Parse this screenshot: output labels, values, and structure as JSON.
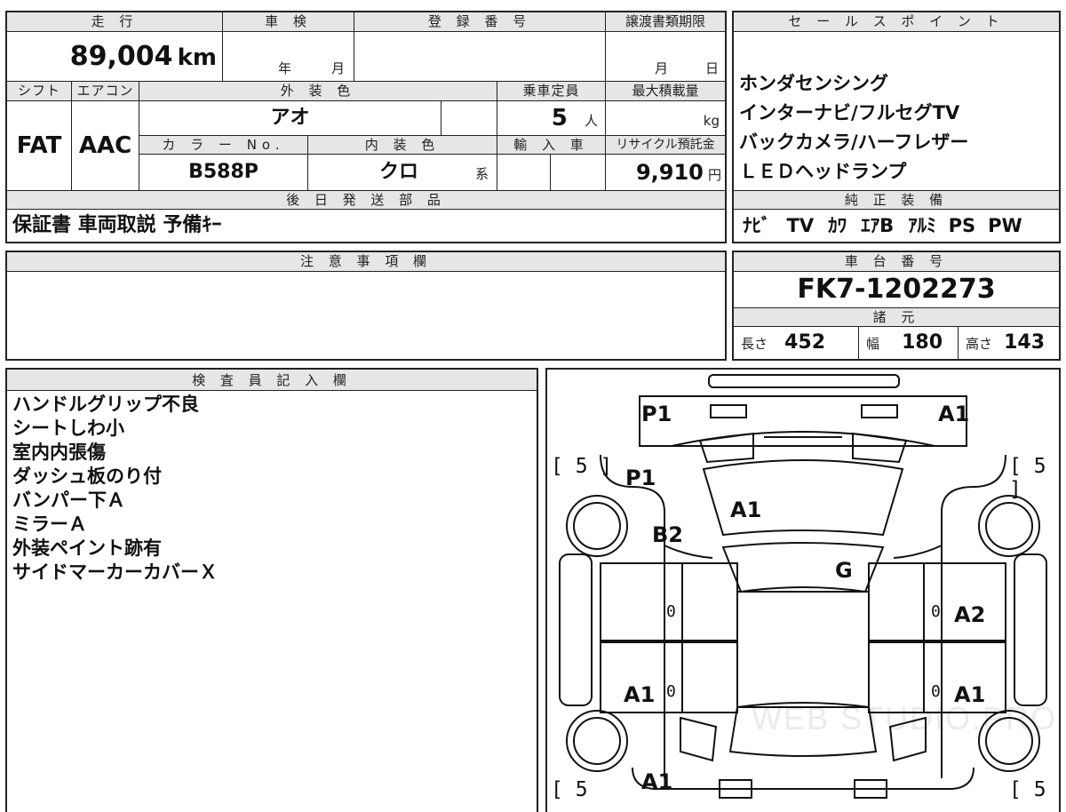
{
  "vehicle": {
    "mileage_label": "走 行",
    "mileage_value": "89,004",
    "mileage_unit": "km",
    "inspection_label": "車 検",
    "inspection_year_unit": "年",
    "inspection_month_unit": "月",
    "registration_label": "登 録 番 号",
    "transfer_deadline_label": "譲渡書類期限",
    "transfer_month_unit": "月",
    "transfer_day_unit": "日",
    "shift_label": "シフト",
    "shift_value": "FAT",
    "ac_label": "エアコン",
    "ac_value": "AAC",
    "exterior_color_label": "外 装 色",
    "exterior_color_value": "アオ",
    "capacity_label": "乗車定員",
    "capacity_value": "5",
    "capacity_unit": "人",
    "max_load_label": "最大積載量",
    "max_load_unit": "kg",
    "color_no_label": "カ ラ ー No.",
    "color_no_value": "B588P",
    "interior_color_label": "内 装 色",
    "interior_color_value": "クロ",
    "interior_color_suffix": "系",
    "import_label": "輸 入 車",
    "recycle_label": "リサイクル預託金",
    "recycle_value": "9,910",
    "recycle_unit": "円",
    "later_parts_label": "後 日 発 送 部 品",
    "later_parts_value": "保証書 車両取説 予備ｷｰ"
  },
  "sales_points": {
    "label": "セ ー ル ス ポ イ ン ト",
    "items": [
      "ホンダセンシング",
      "インターナビ/フルセグTV",
      "バックカメラ/ハーフレザー",
      "ＬＥＤヘッドランプ"
    ]
  },
  "equipment": {
    "label": "純 正 装 備",
    "items": [
      "ﾅﾋﾞ",
      "TV",
      "ｶﾜ",
      "ｴｱB",
      "ｱﾙﾐ",
      "PS",
      "PW"
    ]
  },
  "notes": {
    "label": "注 意 事 項 欄"
  },
  "chassis": {
    "label": "車 台 番 号",
    "value": "FK7-1202273",
    "specs_label": "諸 元",
    "length_label": "長さ",
    "length_value": "452",
    "width_label": "幅",
    "width_value": "180",
    "height_label": "高さ",
    "height_value": "143"
  },
  "inspector": {
    "label": "検 査 員 記 入 欄",
    "lines": [
      "ハンドルグリップ不良",
      "シートしわ小",
      "室内内張傷",
      "ダッシュ板のり付",
      "バンパー下Ａ",
      "ミラーＡ",
      "外装ペイント跡有",
      "サイドマーカーカバーＸ"
    ]
  },
  "diagram": {
    "marks": {
      "front_left": "P1",
      "front_right": "A1",
      "fender_left": "P1",
      "windshield": "A1",
      "door_area_left": "B2",
      "roof_glass": "G",
      "rear_door_right": "A2",
      "rear_left": "A1",
      "rear_right": "A1",
      "rear_bumper": "A1"
    },
    "tire_depths": {
      "front_left": "[ 5 ]",
      "front_right": "[ 5 ]",
      "rear_left": "[ 5",
      "rear_right": "[ 5"
    },
    "zeros": [
      "0",
      "0",
      "0",
      "0"
    ],
    "watermark": "WEB STUDIO.PRO"
  }
}
